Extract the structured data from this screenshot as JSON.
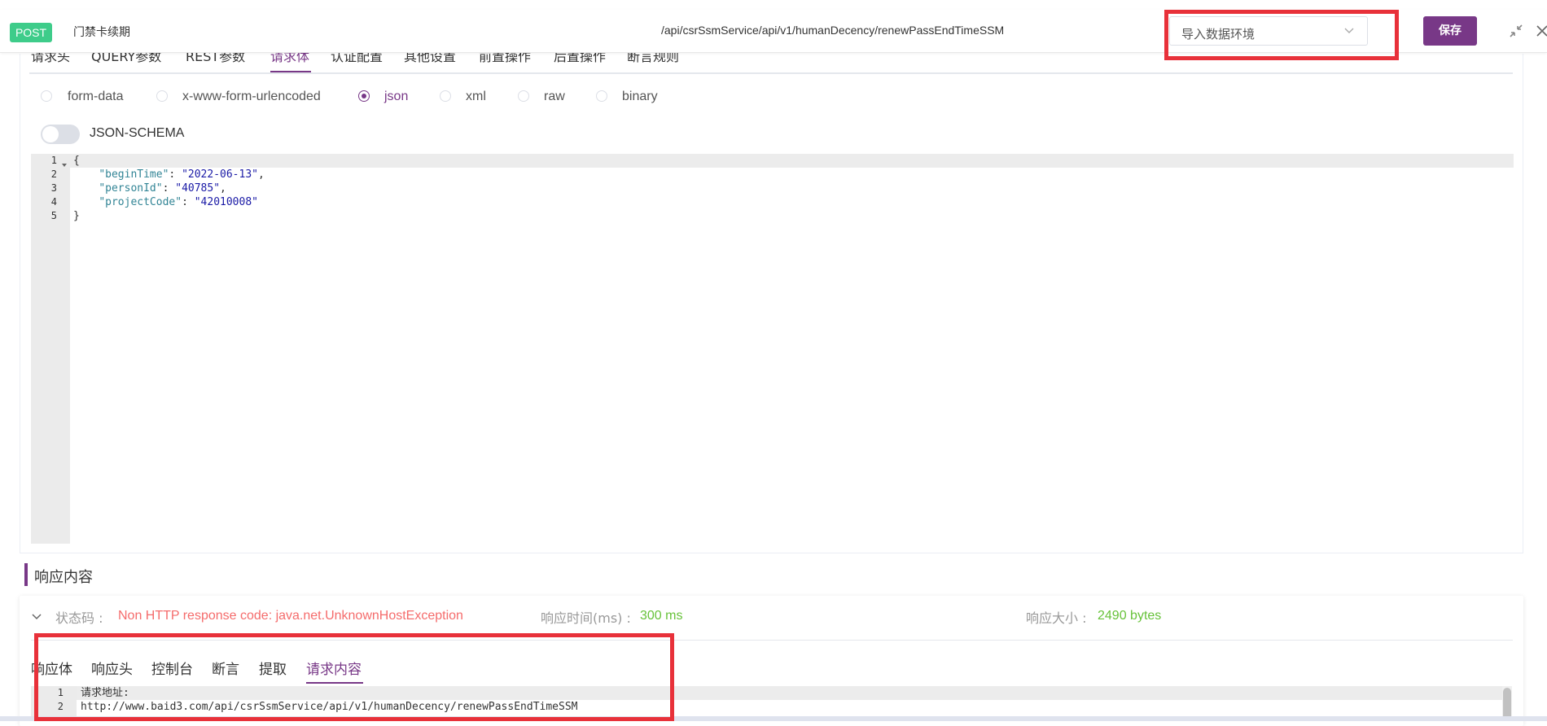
{
  "header": {
    "method": "POST",
    "api_name": "门禁卡续期",
    "api_path": "/api/csrSsmService/api/v1/humanDecency/renewPassEndTimeSSM",
    "env_placeholder": "导入数据环境",
    "save_label": "保存"
  },
  "request_tabs": [
    {
      "label": "请求头"
    },
    {
      "label": "QUERY参数"
    },
    {
      "label": "REST参数"
    },
    {
      "label": "请求体"
    },
    {
      "label": "认证配置"
    },
    {
      "label": "其他设置"
    },
    {
      "label": "前置操作"
    },
    {
      "label": "后置操作"
    },
    {
      "label": "断言规则"
    }
  ],
  "body_types": [
    {
      "label": "form-data",
      "checked": false
    },
    {
      "label": "x-www-form-urlencoded",
      "checked": false
    },
    {
      "label": "json",
      "checked": true
    },
    {
      "label": "xml",
      "checked": false
    },
    {
      "label": "raw",
      "checked": false
    },
    {
      "label": "binary",
      "checked": false
    }
  ],
  "json_schema_label": "JSON-SCHEMA",
  "editor": {
    "line_numbers": [
      "1",
      "2",
      "3",
      "4",
      "5"
    ],
    "lines": {
      "l1": "{",
      "l2_key": "\"beginTime\"",
      "l2_val": "\"2022-06-13\"",
      "l3_key": "\"personId\"",
      "l3_val": "\"40785\"",
      "l4_key": "\"projectCode\"",
      "l4_val": "\"42010008\"",
      "l5": "}"
    }
  },
  "response": {
    "title": "响应内容",
    "status_label": "状态码 :",
    "status_value": "Non HTTP response code: java.net.UnknownHostException",
    "time_label": "响应时间(ms) :",
    "time_value": "300 ms",
    "size_label": "响应大小 :",
    "size_value": "2490 bytes",
    "tabs": [
      "响应体",
      "响应头",
      "控制台",
      "断言",
      "提取",
      "请求内容"
    ],
    "content_line_numbers": [
      "1",
      "2"
    ],
    "content_lines": [
      "请求地址:",
      "http://www.baid3.com/api/csrSsmService/api/v1/humanDecency/renewPassEndTimeSSM"
    ]
  },
  "colors": {
    "accent": "#783887",
    "method_badge": "#3ecc8a",
    "highlight_box": "#e8313a",
    "error": "#f56c6c",
    "success": "#67c23a"
  }
}
